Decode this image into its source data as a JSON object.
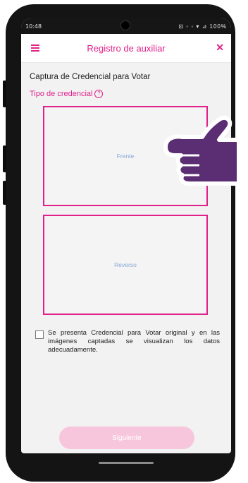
{
  "status_bar": {
    "time": "10:48",
    "indicators": "⊡ ◦ ◦ ▾ ⊿ 100%"
  },
  "app_bar": {
    "title": "Registro de auxiliar",
    "menu_icon": "hamburger-menu-icon",
    "close_icon": "close-icon"
  },
  "form": {
    "section_title": "Captura de Credencial para Votar",
    "subtitle": "Tipo de credencial",
    "front_label": "Frente",
    "back_label": "Reverso",
    "checkbox_label": "Se presenta Credencial para Votar original y en las imágenes captadas se visualizan los datos adecuadamente.",
    "checkbox_checked": false,
    "next_button": "Siguiente"
  },
  "colors": {
    "accent": "#e0218a",
    "button_disabled": "#f8c6dc",
    "hand_fill": "#5b2d73"
  }
}
